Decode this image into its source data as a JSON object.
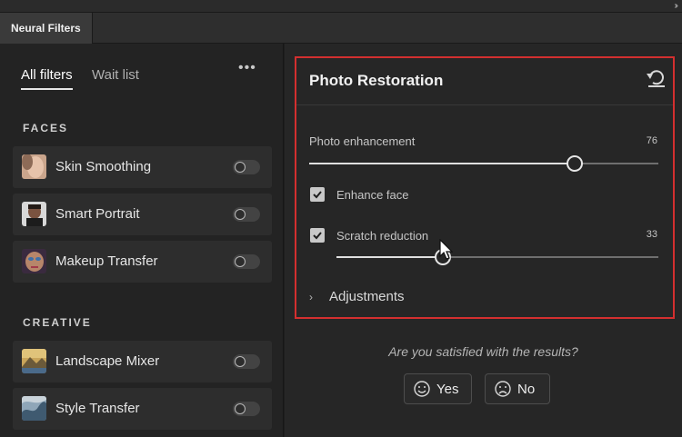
{
  "panel": {
    "tab_label": "Neural Filters"
  },
  "sidebar": {
    "tabs": [
      {
        "label": "All filters",
        "active": true
      },
      {
        "label": "Wait list",
        "active": false
      }
    ],
    "sections": [
      {
        "label": "FACES",
        "items": [
          {
            "label": "Skin Smoothing",
            "enabled": false
          },
          {
            "label": "Smart Portrait",
            "enabled": false
          },
          {
            "label": "Makeup Transfer",
            "enabled": false
          }
        ]
      },
      {
        "label": "CREATIVE",
        "items": [
          {
            "label": "Landscape Mixer",
            "enabled": false
          },
          {
            "label": "Style Transfer",
            "enabled": false
          }
        ]
      }
    ]
  },
  "restoration": {
    "title": "Photo Restoration",
    "photo_enhancement": {
      "label": "Photo enhancement",
      "value": "76"
    },
    "enhance_face": {
      "label": "Enhance face",
      "checked": true
    },
    "scratch_reduction": {
      "label": "Scratch reduction",
      "checked": true,
      "value": "33"
    },
    "adjustments": {
      "label": "Adjustments"
    }
  },
  "feedback": {
    "question": "Are you satisfied with the results?",
    "yes_label": "Yes",
    "no_label": "No"
  },
  "colors": {
    "highlight_border": "#d32f2f",
    "panel_bg": "#262626",
    "sidebar_bg": "#232323"
  }
}
